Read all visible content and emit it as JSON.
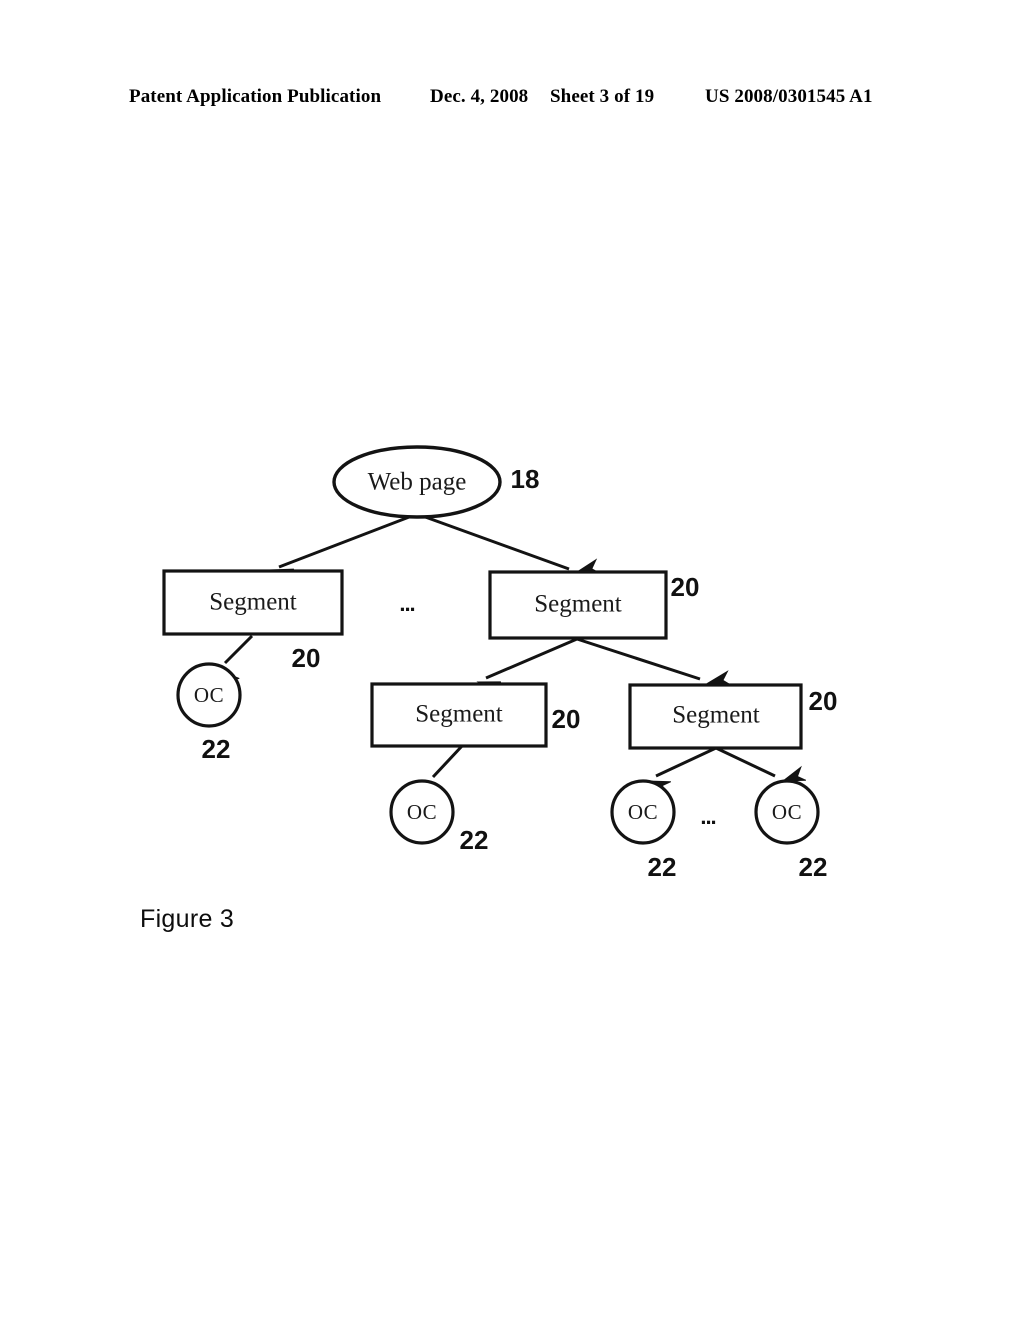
{
  "header": {
    "publication": "Patent Application Publication",
    "date": "Dec. 4, 2008",
    "sheet": "Sheet 3 of 19",
    "patent_number": "US 2008/0301545 A1"
  },
  "figure": {
    "caption": "Figure 3",
    "ellipsis": "...",
    "nodes": {
      "root": {
        "label": "Web page",
        "ref": "18"
      },
      "segment_l1_left": {
        "label": "Segment",
        "ref": "20"
      },
      "segment_l1_right": {
        "label": "Segment",
        "ref": "20"
      },
      "segment_l2_left": {
        "label": "Segment",
        "ref": "20"
      },
      "segment_l2_right": {
        "label": "Segment",
        "ref": "20"
      },
      "oc_left": {
        "label": "OC",
        "ref": "22"
      },
      "oc_mid": {
        "label": "OC",
        "ref": "22"
      },
      "oc_right_a": {
        "label": "OC",
        "ref": "22"
      },
      "oc_right_b": {
        "label": "OC",
        "ref": "22"
      }
    }
  },
  "colors": {
    "ink": "#131313",
    "paper": "#ffffff"
  }
}
